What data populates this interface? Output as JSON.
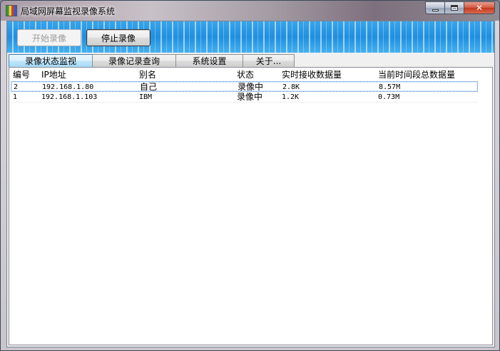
{
  "window": {
    "title": "局域网屏幕监视录像系统"
  },
  "toolbar": {
    "start_label": "开始录像",
    "stop_label": "停止录像"
  },
  "tabs": [
    {
      "label": "录像状态监视",
      "active": true
    },
    {
      "label": "录像记录查询",
      "active": false
    },
    {
      "label": "系统设置",
      "active": false
    },
    {
      "label": "关于...",
      "active": false
    }
  ],
  "table": {
    "columns": [
      "编号",
      "IP地址",
      "别名",
      "状态",
      "实时接收数据量",
      "当前时间段总数据量"
    ],
    "rows": [
      {
        "id": "2",
        "ip": "192.168.1.80",
        "alias": "自己",
        "status": "录像中",
        "realtime": "2.8K",
        "total": "8.57M",
        "selected": true
      },
      {
        "id": "1",
        "ip": "192.168.1.103",
        "alias": "IBM",
        "status": "录像中",
        "realtime": "1.2K",
        "total": "0.73M",
        "selected": false
      }
    ]
  },
  "colors": {
    "banner": "#1f8fe0",
    "selection_border": "#3875d7"
  }
}
